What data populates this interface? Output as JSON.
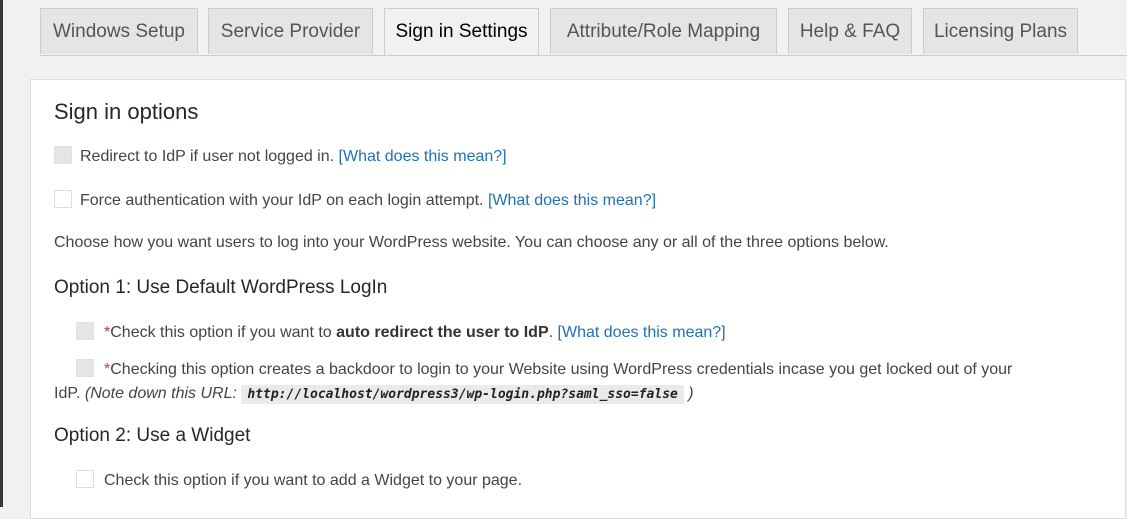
{
  "tabs": [
    {
      "label": "Windows Setup",
      "active": false
    },
    {
      "label": "Service Provider",
      "active": false
    },
    {
      "label": "Sign in Settings",
      "active": true
    },
    {
      "label": "Attribute/Role Mapping",
      "active": false
    },
    {
      "label": "Help & FAQ",
      "active": false
    },
    {
      "label": "Licensing Plans",
      "active": false
    }
  ],
  "section": {
    "title": "Sign in options",
    "redirect": {
      "text": "Redirect to IdP if user not logged in.",
      "link": "[What does this mean?]",
      "checked": false,
      "disabled": true
    },
    "force": {
      "text": "Force authentication with your IdP on each login attempt.",
      "link": "[What does this mean?]",
      "checked": false,
      "disabled": false
    },
    "intro": "Choose how you want users to log into your WordPress website. You can choose any or all of the three options below."
  },
  "option1": {
    "title": "Option 1: Use Default WordPress LogIn",
    "auto_redirect": {
      "asterisk": "*",
      "pre": "Check this option if you want to",
      "bold": "auto redirect the user to IdP",
      "post": ".",
      "link": "[What does this mean?]",
      "disabled": true
    },
    "backdoor": {
      "asterisk": "*",
      "line1": "Checking this option creates a backdoor to login to your Website using WordPress credentials incase you get locked out of your",
      "line2_pre": "IdP.",
      "note": "(Note down this URL:",
      "url": "http://localhost/wordpress3/wp-login.php?saml_sso=false",
      "note_end": ")",
      "disabled": true
    }
  },
  "option2": {
    "title": "Option 2: Use a Widget",
    "widget": {
      "text": "Check this option if you want to add a Widget to your page.",
      "checked": false
    }
  }
}
